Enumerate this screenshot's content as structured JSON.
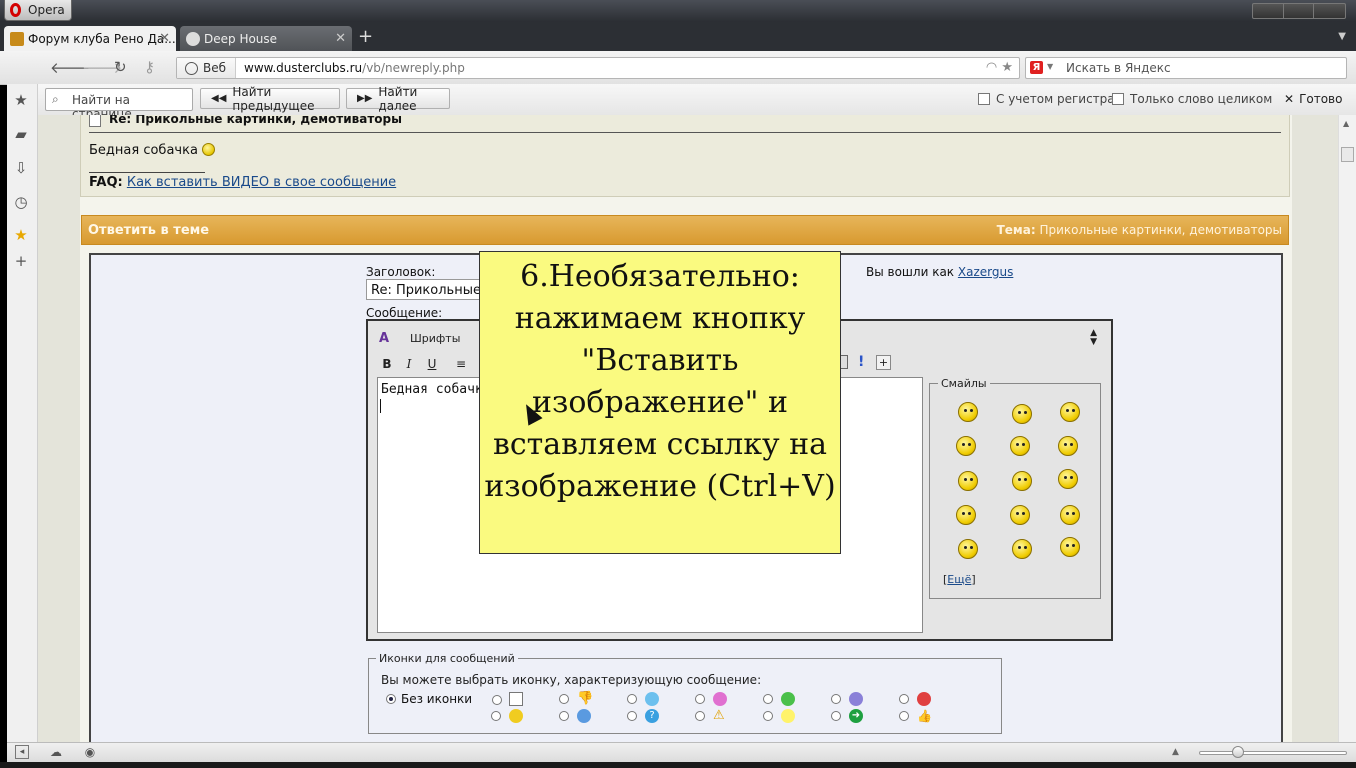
{
  "browser": {
    "menu_label": "Opera",
    "tabs": [
      {
        "label": "Форум клуба Рено Да...",
        "active": true
      },
      {
        "label": "Deep House",
        "active": false
      }
    ],
    "address": {
      "badge": "Веб",
      "host": "www.dusterclubs.ru",
      "path": "/vb/newreply.php"
    },
    "search_placeholder": "Искать в Яндекс"
  },
  "findbar": {
    "placeholder": "Найти на странице",
    "prev_label": "Найти предыдущее",
    "next_label": "Найти далее",
    "match_case_label": "С учетом регистра",
    "whole_word_label": "Только слово целиком",
    "done_label": "Готово"
  },
  "post": {
    "title": "Re: Прикольные картинки, демотиваторы",
    "text": "Бедная собачка",
    "faq_label": "FAQ:",
    "faq_link": "Как вставить ВИДЕО в свое сообщение"
  },
  "reply": {
    "header_title": "Ответить в теме",
    "topic_label": "Тема:",
    "topic_value": "Прикольные картинки, демотиваторы",
    "subject_label": "Заголовок:",
    "subject_value": "Re: Прикольные",
    "logged_in_label": "Вы вошли как",
    "username": "Xazergus",
    "message_label": "Сообщение:",
    "font_select": "Шрифты",
    "message_text": "Бедная собачк",
    "smilies_legend": "Смайлы",
    "more_smilies": "Ещё",
    "icons_legend": "Иконки для сообщений",
    "icons_description": "Вы можете выбрать иконку, характеризующую сообщение:",
    "no_icon_label": "Без иконки"
  },
  "tooltip": {
    "text": "6.Необязательно: нажимаем кнопку \"Вставить изображение\" и вставляем ссылку на изображение (Ctrl+V)"
  },
  "colors": {
    "reply_header": "#e0a445",
    "tooltip_bg": "#fafa80",
    "link": "#1a4a8a"
  }
}
